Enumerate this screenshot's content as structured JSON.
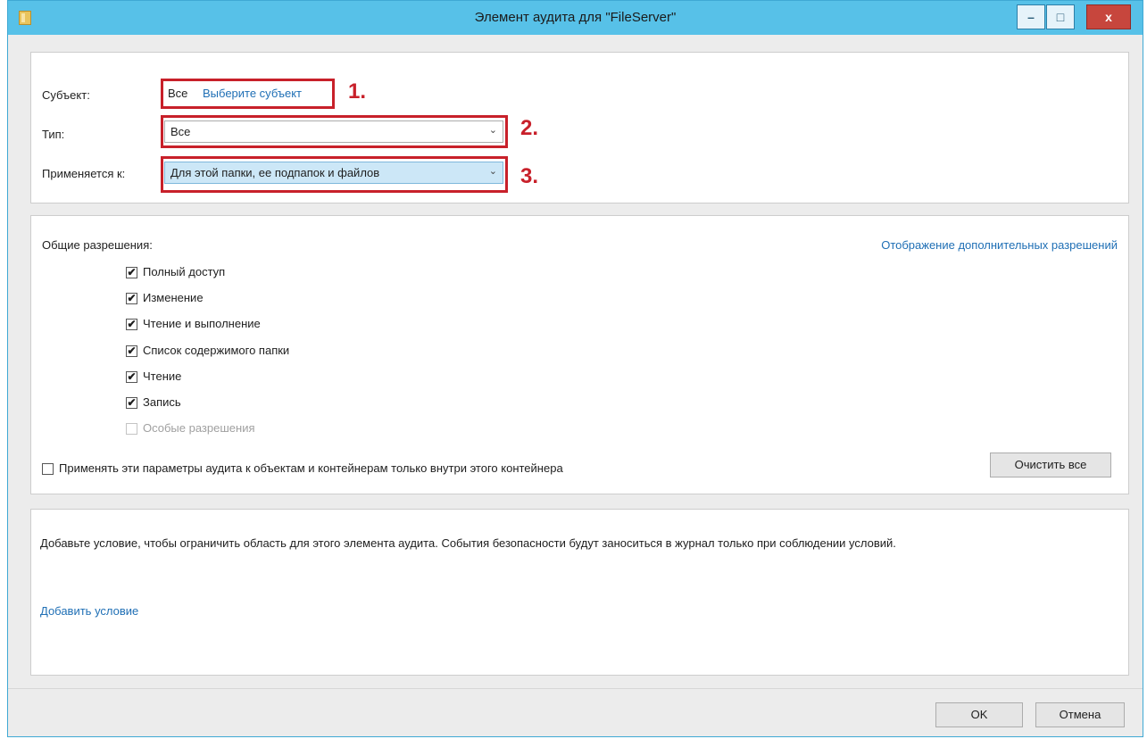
{
  "window": {
    "title": "Элемент аудита для \"FileServer\"",
    "minimize_glyph": "–",
    "maximize_glyph": "□",
    "close_glyph": "x"
  },
  "principal": {
    "label": "Субъект:",
    "value": "Все",
    "select_link": "Выберите субъект",
    "annotation": "1."
  },
  "type": {
    "label": "Тип:",
    "value": "Все",
    "annotation": "2."
  },
  "applies_to": {
    "label": "Применяется к:",
    "value": "Для этой папки, ее подпапок и файлов",
    "annotation": "3."
  },
  "permissions": {
    "heading": "Общие разрешения:",
    "show_advanced_link": "Отображение дополнительных разрешений",
    "items": [
      {
        "label": "Полный доступ",
        "checked": true,
        "enabled": true
      },
      {
        "label": "Изменение",
        "checked": true,
        "enabled": true
      },
      {
        "label": "Чтение и выполнение",
        "checked": true,
        "enabled": true
      },
      {
        "label": "Список содержимого папки",
        "checked": true,
        "enabled": true
      },
      {
        "label": "Чтение",
        "checked": true,
        "enabled": true
      },
      {
        "label": "Запись",
        "checked": true,
        "enabled": true
      },
      {
        "label": "Особые разрешения",
        "checked": false,
        "enabled": false
      }
    ],
    "apply_inside_label": "Применять эти параметры аудита к объектам и контейнерам только внутри этого контейнера",
    "apply_inside_checked": false,
    "clear_all_button": "Очистить все"
  },
  "condition": {
    "description": "Добавьте условие, чтобы ограничить область для этого элемента аудита. События безопасности будут заноситься в журнал только при соблюдении условий.",
    "add_link": "Добавить условие"
  },
  "footer": {
    "ok_button": "OK",
    "cancel_button": "Отмена"
  },
  "colors": {
    "titlebar": "#57c1e8",
    "annotation_red": "#c8202a",
    "link_blue": "#1f6fb5",
    "close_button": "#c7463d"
  },
  "icons": {
    "app": "folder-icon",
    "checkmark": "✔",
    "dropdown": "chevron-down-icon"
  }
}
